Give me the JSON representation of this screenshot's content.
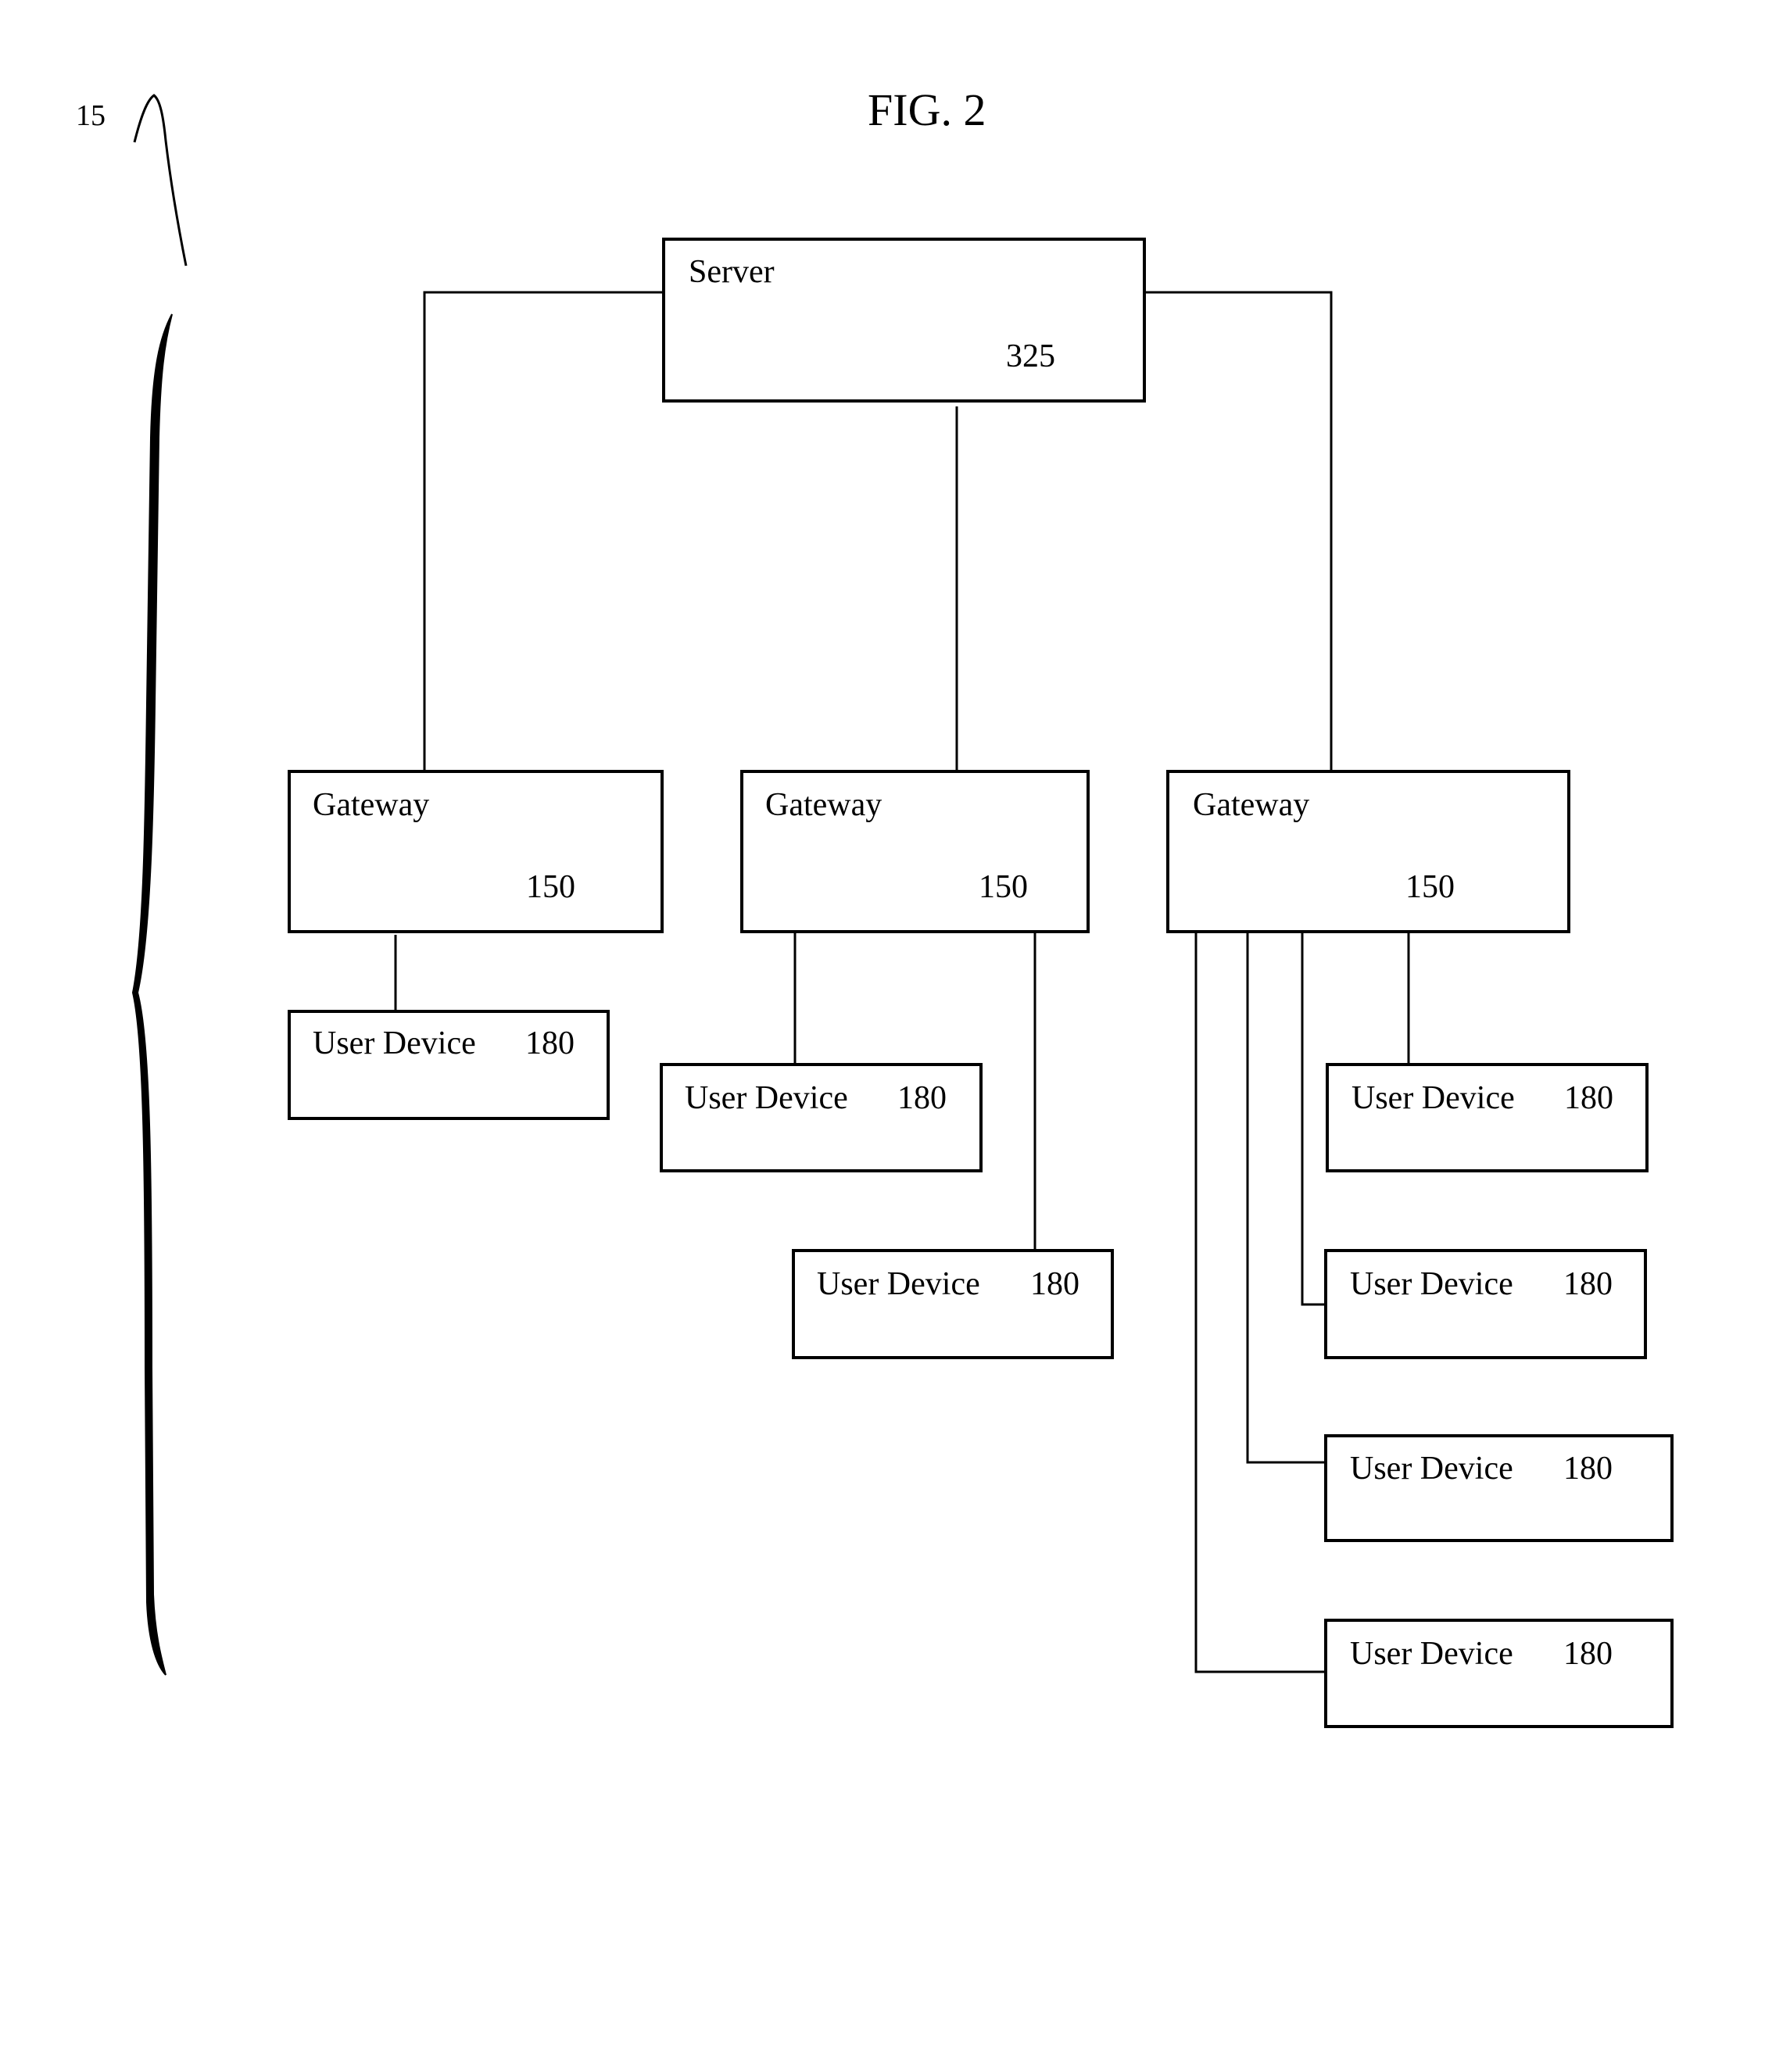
{
  "figure": {
    "title": "FIG. 2",
    "system_ref": "15"
  },
  "server": {
    "label": "Server",
    "ref": "325"
  },
  "gateways": [
    {
      "label": "Gateway",
      "ref": "150"
    },
    {
      "label": "Gateway",
      "ref": "150"
    },
    {
      "label": "Gateway",
      "ref": "150"
    }
  ],
  "user_devices": [
    {
      "label": "User Device",
      "ref": "180",
      "gateway": 0
    },
    {
      "label": "User Device",
      "ref": "180",
      "gateway": 1
    },
    {
      "label": "User Device",
      "ref": "180",
      "gateway": 1
    },
    {
      "label": "User Device",
      "ref": "180",
      "gateway": 2
    },
    {
      "label": "User Device",
      "ref": "180",
      "gateway": 2
    },
    {
      "label": "User Device",
      "ref": "180",
      "gateway": 2
    },
    {
      "label": "User Device",
      "ref": "180",
      "gateway": 2
    }
  ]
}
